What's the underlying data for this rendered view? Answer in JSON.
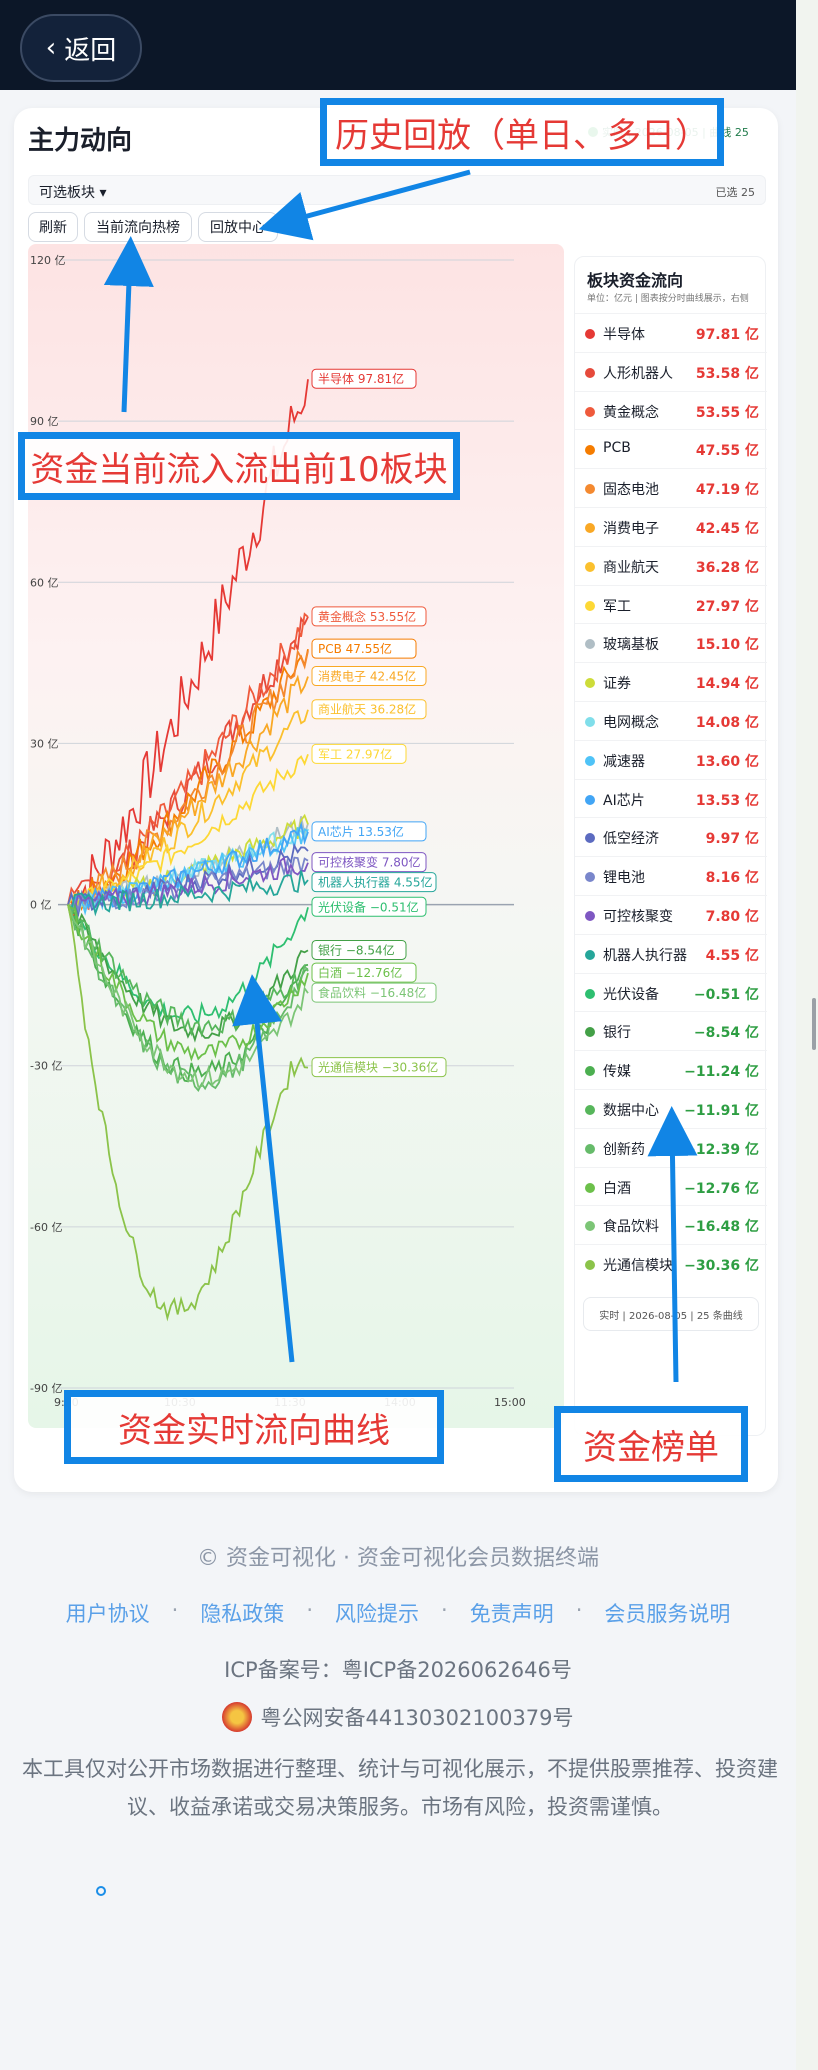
{
  "nav": {
    "back_label": "返回"
  },
  "header": {
    "title": "主力动向",
    "status_text": "实时 | 2026-08-05 | 曲线 25"
  },
  "selector": {
    "label": "可选板块 ▾",
    "selected": "已选 25"
  },
  "chips": [
    "刷新",
    "当前流向热榜",
    "回放中心"
  ],
  "chart_data": {
    "type": "line",
    "ylabel_unit": "亿",
    "yticks": [
      "120 亿",
      "90 亿",
      "60 亿",
      "30 亿",
      "0 亿",
      "-30 亿",
      "-60 亿",
      "-90 亿"
    ],
    "ylim": [
      -90,
      120
    ],
    "xticks": [
      "9:30",
      "10:30",
      "11:30",
      "14:00",
      "15:00"
    ],
    "grid": true,
    "series": [
      {
        "name": "半导体",
        "color": "#e53935",
        "end": 97.81,
        "label": "半导体 97.81亿"
      },
      {
        "name": "人形机器人",
        "color": "#e64a3b",
        "end": 53.58,
        "label": ""
      },
      {
        "name": "黄金概念",
        "color": "#ef5a3c",
        "end": 53.55,
        "label": "黄金概念 53.55亿"
      },
      {
        "name": "PCB",
        "color": "#f57c00",
        "end": 47.55,
        "label": "PCB 47.55亿"
      },
      {
        "name": "固态电池",
        "color": "#f4892f",
        "end": 47.19,
        "label": ""
      },
      {
        "name": "消费电子",
        "color": "#f9a825",
        "end": 42.45,
        "label": "消费电子 42.45亿"
      },
      {
        "name": "商业航天",
        "color": "#fbc02d",
        "end": 36.28,
        "label": "商业航天 36.28亿"
      },
      {
        "name": "军工",
        "color": "#fdd835",
        "end": 27.97,
        "label": "军工 27.97亿"
      },
      {
        "name": "玻璃基板",
        "color": "#b0bec5",
        "end": 15.1,
        "label": ""
      },
      {
        "name": "证券",
        "color": "#cddc39",
        "end": 14.94,
        "label": ""
      },
      {
        "name": "电网概念",
        "color": "#80deea",
        "end": 14.08,
        "label": ""
      },
      {
        "name": "减速器",
        "color": "#4fc3f7",
        "end": 13.6,
        "label": ""
      },
      {
        "name": "AI芯片",
        "color": "#42a5f5",
        "end": 13.53,
        "label": "AI芯片 13.53亿"
      },
      {
        "name": "低空经济",
        "color": "#5c6bc0",
        "end": 9.97,
        "label": ""
      },
      {
        "name": "锂电池",
        "color": "#7986cb",
        "end": 8.16,
        "label": ""
      },
      {
        "name": "可控核聚变",
        "color": "#7e57c2",
        "end": 7.8,
        "label": "可控核聚变 7.80亿"
      },
      {
        "name": "机器人执行器",
        "color": "#26a69a",
        "end": 4.55,
        "label": "机器人执行器 4.55亿"
      },
      {
        "name": "光伏设备",
        "color": "#2ebf70",
        "end": -0.51,
        "label": "光伏设备 −0.51亿"
      },
      {
        "name": "银行",
        "color": "#43a047",
        "end": -8.54,
        "label": "银行 −8.54亿"
      },
      {
        "name": "传媒",
        "color": "#4caf50",
        "end": -11.24,
        "label": ""
      },
      {
        "name": "数据中心",
        "color": "#57b65b",
        "end": -11.91,
        "label": ""
      },
      {
        "name": "创新药",
        "color": "#66bb6a",
        "end": -12.39,
        "label": ""
      },
      {
        "name": "白酒",
        "color": "#6cc04a",
        "end": -12.76,
        "label": "白酒 −12.76亿"
      },
      {
        "name": "食品饮料",
        "color": "#7cc576",
        "end": -16.48,
        "label": "食品饮料 −16.48亿"
      },
      {
        "name": "光通信模块",
        "color": "#8bc34a",
        "end": -30.36,
        "label": "光通信模块 −30.36亿"
      }
    ]
  },
  "side_panel": {
    "title": "板块资金流向",
    "subtitle": "单位：亿元 | 图表按分时曲线展示，右侧",
    "rows": [
      {
        "name": "半导体",
        "value": "97.81 亿",
        "color": "#e53935",
        "pos": true
      },
      {
        "name": "人形机器人",
        "value": "53.58 亿",
        "color": "#e64a3b",
        "pos": true
      },
      {
        "name": "黄金概念",
        "value": "53.55 亿",
        "color": "#ef5a3c",
        "pos": true
      },
      {
        "name": "PCB",
        "value": "47.55 亿",
        "color": "#f57c00",
        "pos": true
      },
      {
        "name": "固态电池",
        "value": "47.19 亿",
        "color": "#f4892f",
        "pos": true
      },
      {
        "name": "消费电子",
        "value": "42.45 亿",
        "color": "#f9a825",
        "pos": true
      },
      {
        "name": "商业航天",
        "value": "36.28 亿",
        "color": "#fbc02d",
        "pos": true
      },
      {
        "name": "军工",
        "value": "27.97 亿",
        "color": "#fdd835",
        "pos": true
      },
      {
        "name": "玻璃基板",
        "value": "15.10 亿",
        "color": "#b0bec5",
        "pos": true
      },
      {
        "name": "证券",
        "value": "14.94 亿",
        "color": "#cddc39",
        "pos": true
      },
      {
        "name": "电网概念",
        "value": "14.08 亿",
        "color": "#80deea",
        "pos": true
      },
      {
        "name": "减速器",
        "value": "13.60 亿",
        "color": "#4fc3f7",
        "pos": true
      },
      {
        "name": "AI芯片",
        "value": "13.53 亿",
        "color": "#42a5f5",
        "pos": true
      },
      {
        "name": "低空经济",
        "value": "9.97 亿",
        "color": "#5c6bc0",
        "pos": true
      },
      {
        "name": "锂电池",
        "value": "8.16 亿",
        "color": "#7986cb",
        "pos": true
      },
      {
        "name": "可控核聚变",
        "value": "7.80 亿",
        "color": "#7e57c2",
        "pos": true
      },
      {
        "name": "机器人执行器",
        "value": "4.55 亿",
        "color": "#26a69a",
        "pos": true
      },
      {
        "name": "光伏设备",
        "value": "−0.51 亿",
        "color": "#2ebf70",
        "pos": false
      },
      {
        "name": "银行",
        "value": "−8.54 亿",
        "color": "#43a047",
        "pos": false
      },
      {
        "name": "传媒",
        "value": "−11.24 亿",
        "color": "#4caf50",
        "pos": false
      },
      {
        "name": "数据中心",
        "value": "−11.91 亿",
        "color": "#57b65b",
        "pos": false
      },
      {
        "name": "创新药",
        "value": "−12.39 亿",
        "color": "#66bb6a",
        "pos": false
      },
      {
        "name": "白酒",
        "value": "−12.76 亿",
        "color": "#6cc04a",
        "pos": false
      },
      {
        "name": "食品饮料",
        "value": "−16.48 亿",
        "color": "#7cc576",
        "pos": false
      },
      {
        "name": "光通信模块",
        "value": "−30.36 亿",
        "color": "#8bc34a",
        "pos": false
      }
    ],
    "footer": "实时 | 2026-08-05 | 25 条曲线"
  },
  "annotations": {
    "history": "历史回放（单日、多日）",
    "top10": "资金当前流入流出前10板块",
    "curve": "资金实时流向曲线",
    "ranking": "资金榜单"
  },
  "colors": {
    "annotation_border": "#1185e5",
    "annotation_text": "#e53935",
    "positive": "#e53935",
    "negative": "#2e9e43"
  },
  "footer": {
    "copyright": "© 资金可视化 · 资金可视化会员数据终端",
    "links": [
      "用户协议",
      "隐私政策",
      "风险提示",
      "免责声明",
      "会员服务说明"
    ],
    "icp": "ICP备案号：粤ICP备2026062646号",
    "police": "粤公网安备44130302100379号",
    "disclaimer": "本工具仅对公开市场数据进行整理、统计与可视化展示，不提供股票推荐、投资建议、收益承诺或交易决策服务。市场有风险，投资需谨慎。"
  }
}
